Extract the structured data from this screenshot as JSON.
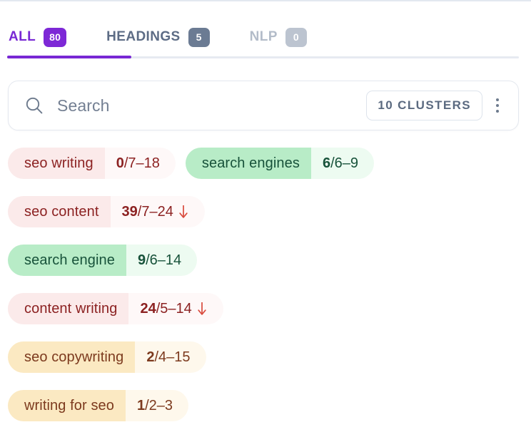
{
  "tabs": [
    {
      "id": "all",
      "label": "ALL",
      "badge": "80",
      "state": "active",
      "color": "#7827d4"
    },
    {
      "id": "headings",
      "label": "HEADINGS",
      "badge": "5",
      "state": "inactive",
      "color": "#5d6c85"
    },
    {
      "id": "nlp",
      "label": "NLP",
      "badge": "0",
      "state": "disabled",
      "color": "#b3bcc9"
    }
  ],
  "search": {
    "placeholder": "Search",
    "value": "",
    "icon": "search-icon",
    "clusters_label": "10 CLUSTERS",
    "menu_icon": "kebab-menu-icon"
  },
  "keywords": [
    {
      "term": "seo writing",
      "stat_main": "0",
      "stat_rest": "/7–18",
      "tone": "red",
      "trend": "",
      "full": "0/7–18"
    },
    {
      "term": "search engines",
      "stat_main": "6",
      "stat_rest": "/6–9",
      "tone": "green",
      "trend": "",
      "full": "6/6–9"
    },
    {
      "term": "seo content",
      "stat_main": "39",
      "stat_rest": "/7–24",
      "tone": "red",
      "trend": "down",
      "full": "39/7–24"
    },
    {
      "term": "search engine",
      "stat_main": "9",
      "stat_rest": "/6–14",
      "tone": "green",
      "trend": "",
      "full": "9/6–14"
    },
    {
      "term": "content writing",
      "stat_main": "24",
      "stat_rest": "/5–14",
      "tone": "red",
      "trend": "down",
      "full": "24/5–14"
    },
    {
      "term": "seo copywriting",
      "stat_main": "2",
      "stat_rest": "/4–15",
      "tone": "amber",
      "trend": "",
      "full": "2/4–15"
    },
    {
      "term": "writing for seo",
      "stat_main": "1",
      "stat_rest": "/2–3",
      "tone": "amber",
      "trend": "",
      "full": "1/2–3"
    }
  ],
  "colors": {
    "accent_purple": "#7827d4",
    "tone_red_bg": "#fbeaea",
    "tone_red_text": "#8c2222",
    "tone_green_bg": "#b8ecc7",
    "tone_green_text": "#17523a",
    "tone_amber_bg": "#fbe9c2",
    "tone_amber_text": "#7c3a1e",
    "trend_down": "#d94a3d"
  }
}
